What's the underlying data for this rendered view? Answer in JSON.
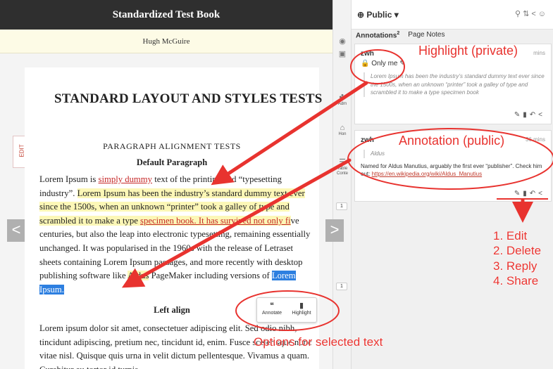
{
  "book": {
    "title": "Standardized Test Book",
    "author": "Hugh McGuire",
    "edit_tab": "EDIT",
    "heading": "STANDARD LAYOUT AND STYLES TESTS",
    "section_title": "PARAGRAPH ALIGNMENT TESTS",
    "default_heading": "Default Paragraph",
    "left_heading": "Left align",
    "para1": {
      "t1": "Lorem Ipsum is ",
      "t2": "simply dummy",
      "t3": " text of the printing and “typesetting industry”. ",
      "t4": "Lorem Ipsum has been the industry’s standard dummy text ever since the 1500s, when an unknown “printer” took a galley of type and scrambled it to make a type ",
      "t5": "specimen book. It has survived not only fi",
      "t6": "ve centuries, but also the leap into electronic typesetting, remaining essentially unchanged. It was popularised in the 1960s with the release of Letraset sheets containing Lorem Ipsum passages, and more recently with desktop publishing software like ",
      "t7": "Aldus",
      "t8": " PageMaker including versions of ",
      "t9": "Lorem Ipsum."
    },
    "para2": "Lorem ipsum dolor sit amet, consectetuer adipiscing elit. Sed odio nibh, tincidunt adipiscing, pretium nec, tincidunt id, enim. Fusce scelerisque nunc vitae nisl. Quisque quis urna in velit dictum pellentesque. Vivamus a quam. Curabitur eu tortor id turpis",
    "toolbar": {
      "annotate": "Annotate",
      "highlight": "Highlight"
    },
    "nav_prev": "<",
    "nav_next": ">"
  },
  "rail": {
    "adm": "Adm",
    "hon": "Hon",
    "table": "Table",
    "conte": "Conte",
    "count1": "1",
    "count2": "1"
  },
  "sidebar": {
    "group": "Public ▾",
    "tabs": {
      "annotations": "Annotations",
      "annotations_count": "2",
      "page_notes": "Page Notes"
    },
    "card1": {
      "user": "zwh",
      "time": "mins",
      "privacy": "Only me",
      "quote": "Lorem Ipsum has been the industry’s standard dummy text ever since the 1500s, when an unknown “printer” took a galley of type and scrambled it to make a type specimen book"
    },
    "card2": {
      "user": "zwh",
      "time": "36 mins",
      "quote": "Aldus",
      "body": "Named for Aldus Manutius, arguably the first ever “publisher”. Check him out: ",
      "link": "https://en.wikipedia.org/wiki/Aldus_Manutius"
    }
  },
  "callouts": {
    "highlight_private": "Highlight (private)",
    "annotation_public": "Annotation (public)",
    "options": "Options for selected text",
    "list1": "1. Edit",
    "list2": "2. Delete",
    "list3": "3. Reply",
    "list4": "4. Share"
  },
  "colors": {
    "annotation_red": "#e8332f",
    "highlight_yellow": "#fcf7b7",
    "selection_blue": "#2d7fe0"
  }
}
